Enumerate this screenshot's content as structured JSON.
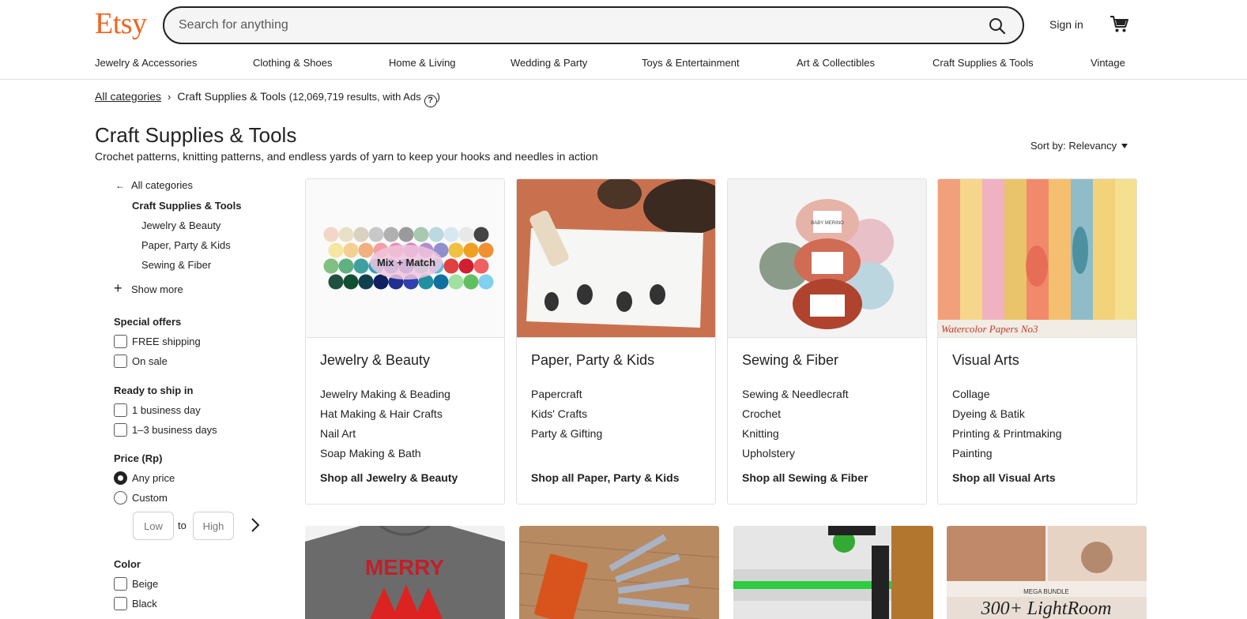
{
  "header": {
    "logo": "Etsy",
    "search_placeholder": "Search for anything",
    "sign_in": "Sign in"
  },
  "nav": [
    "Jewelry & Accessories",
    "Clothing & Shoes",
    "Home & Living",
    "Wedding & Party",
    "Toys & Entertainment",
    "Art & Collectibles",
    "Craft Supplies & Tools",
    "Vintage"
  ],
  "breadcrumb": {
    "all": "All categories",
    "current": "Craft Supplies & Tools",
    "count": "(12,069,719 results, with Ads",
    "help": "?",
    "close": ")"
  },
  "page": {
    "title": "Craft Supplies & Tools",
    "subtitle": "Crochet patterns, knitting patterns, and endless yards of yarn to keep your hooks and needles in action",
    "sort": "Sort by: Relevancy"
  },
  "sidebar": {
    "back": "All categories",
    "current": "Craft Supplies & Tools",
    "children": [
      "Jewelry & Beauty",
      "Paper, Party & Kids",
      "Sewing & Fiber"
    ],
    "show_more": "Show more",
    "special_offers": {
      "heading": "Special offers",
      "options": [
        "FREE shipping",
        "On sale"
      ]
    },
    "ready_to_ship": {
      "heading": "Ready to ship in",
      "options": [
        "1 business day",
        "1–3 business days"
      ]
    },
    "price": {
      "heading": "Price (Rp)",
      "options": [
        "Any price",
        "Custom"
      ],
      "selected": "Any price",
      "low_placeholder": "Low",
      "to": "to",
      "high_placeholder": "High"
    },
    "color": {
      "heading": "Color",
      "options": [
        "Beige",
        "Black"
      ]
    }
  },
  "cards": [
    {
      "title": "Jewelry & Beauty",
      "image_label": "Mix + Match",
      "links": [
        "Jewelry Making & Beading",
        "Hat Making & Hair Crafts",
        "Nail Art",
        "Soap Making & Bath"
      ],
      "shop_all": "Shop all Jewelry & Beauty"
    },
    {
      "title": "Paper, Party & Kids",
      "links": [
        "Papercraft",
        "Kids' Crafts",
        "Party & Gifting"
      ],
      "shop_all": "Shop all Paper, Party & Kids"
    },
    {
      "title": "Sewing & Fiber",
      "image_label": "BABY MERINO",
      "links": [
        "Sewing & Needlecraft",
        "Crochet",
        "Knitting",
        "Upholstery"
      ],
      "shop_all": "Shop all Sewing & Fiber"
    },
    {
      "title": "Visual Arts",
      "image_label": "Watercolor Papers No3",
      "links": [
        "Collage",
        "Dyeing & Batik",
        "Printing & Printmaking",
        "Painting"
      ],
      "shop_all": "Shop all Visual Arts"
    }
  ],
  "tiles": [
    {
      "label": "MERRY"
    },
    {
      "label": ""
    },
    {
      "label": ""
    },
    {
      "label_small": "MEGA BUNDLE",
      "label": "300+ LightRoom"
    }
  ],
  "colors": {
    "brand": "#f1641e"
  }
}
